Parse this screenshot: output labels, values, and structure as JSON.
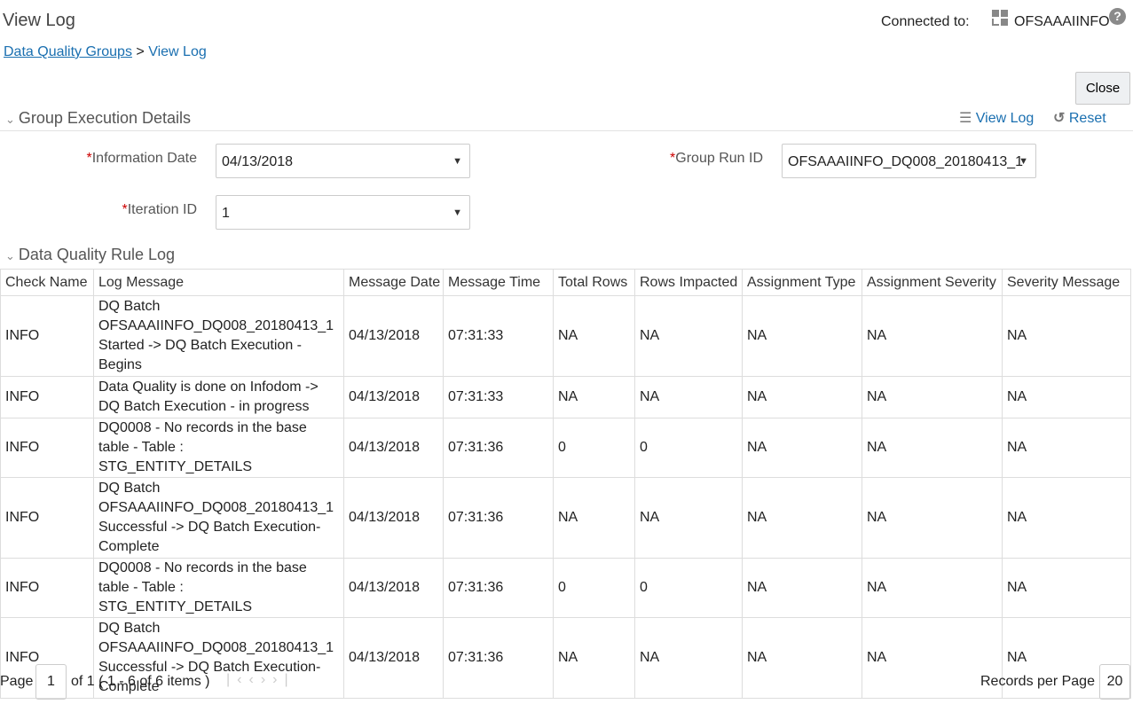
{
  "header": {
    "title": "View Log",
    "connected_label": "Connected to:",
    "server": "OFSAAAIINFO",
    "help": "?"
  },
  "breadcrumb": {
    "parent": "Data Quality Groups",
    "sep": ">",
    "current": "View Log"
  },
  "toolbar": {
    "close": "Close",
    "view_log": "View Log",
    "reset": "Reset"
  },
  "group_section": {
    "title": "Group Execution Details",
    "information_date": {
      "label": "Information Date",
      "value": "04/13/2018"
    },
    "group_run_id": {
      "label": "Group Run ID",
      "value": "OFSAAAIINFO_DQ008_20180413_1"
    },
    "iteration_id": {
      "label": "Iteration ID",
      "value": "1"
    },
    "required": "*"
  },
  "log_section": {
    "title": "Data Quality Rule Log",
    "columns": [
      "Check Name",
      "Log Message",
      "Message Date",
      "Message Time",
      "Total Rows",
      "Rows Impacted",
      "Assignment Type",
      "Assignment Severity",
      "Severity Message"
    ],
    "rows": [
      [
        "INFO",
        "DQ Batch OFSAAAIINFO_DQ008_20180413_1 Started -> DQ Batch Execution - Begins",
        "04/13/2018",
        "07:31:33",
        "NA",
        "NA",
        "NA",
        "NA",
        "NA"
      ],
      [
        "INFO",
        "Data Quality is done on Infodom -> DQ Batch Execution - in progress",
        "04/13/2018",
        "07:31:33",
        "NA",
        "NA",
        "NA",
        "NA",
        "NA"
      ],
      [
        "INFO",
        "DQ0008 - No records in the base table - Table : STG_ENTITY_DETAILS",
        "04/13/2018",
        "07:31:36",
        "0",
        "0",
        "NA",
        "NA",
        "NA"
      ],
      [
        "INFO",
        "DQ Batch OFSAAAIINFO_DQ008_20180413_1 Successful -> DQ Batch Execution-Complete",
        "04/13/2018",
        "07:31:36",
        "NA",
        "NA",
        "NA",
        "NA",
        "NA"
      ],
      [
        "INFO",
        "DQ0008 - No records in the base table - Table : STG_ENTITY_DETAILS",
        "04/13/2018",
        "07:31:36",
        "0",
        "0",
        "NA",
        "NA",
        "NA"
      ],
      [
        "INFO",
        "DQ Batch OFSAAAIINFO_DQ008_20180413_1 Successful -> DQ Batch Execution-Complete",
        "04/13/2018",
        "07:31:36",
        "NA",
        "NA",
        "NA",
        "NA",
        "NA"
      ]
    ]
  },
  "pagination": {
    "page_label": "Page",
    "page": "1",
    "summary": "of 1 ( 1 - 6 of 6 items )",
    "records_label": "Records per Page",
    "records": "20"
  }
}
